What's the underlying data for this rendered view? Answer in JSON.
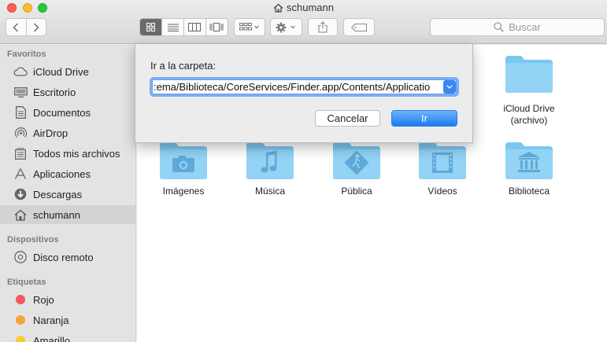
{
  "window": {
    "title": "schumann"
  },
  "toolbar": {
    "back_icon": "chevron-left-icon",
    "forward_icon": "chevron-right-icon",
    "view_modes": [
      "icon-view-icon",
      "list-view-icon",
      "column-view-icon",
      "coverflow-view-icon"
    ],
    "active_view": "icon-view-icon",
    "search_placeholder": "Buscar"
  },
  "sidebar": {
    "sections": [
      {
        "header": "Favoritos",
        "items": [
          {
            "label": "iCloud Drive",
            "icon": "cloud-icon"
          },
          {
            "label": "Escritorio",
            "icon": "desktop-icon"
          },
          {
            "label": "Documentos",
            "icon": "document-icon"
          },
          {
            "label": "AirDrop",
            "icon": "airdrop-icon"
          },
          {
            "label": "Todos mis archivos",
            "icon": "all-files-icon"
          },
          {
            "label": "Aplicaciones",
            "icon": "applications-icon"
          },
          {
            "label": "Descargas",
            "icon": "download-icon"
          },
          {
            "label": "schumann",
            "icon": "home-icon",
            "selected": true
          }
        ]
      },
      {
        "header": "Dispositivos",
        "items": [
          {
            "label": "Disco remoto",
            "icon": "disc-icon"
          }
        ]
      },
      {
        "header": "Etiquetas",
        "items": [
          {
            "label": "Rojo",
            "color": "#f4595b"
          },
          {
            "label": "Naranja",
            "color": "#f7a33a"
          },
          {
            "label": "Amarillo",
            "color": "#f3cf33"
          }
        ]
      }
    ]
  },
  "content": {
    "folders": [
      {
        "label": "iCloud Drive\n(archivo)",
        "icon": "folder-icon"
      },
      {
        "label": "Imágenes",
        "icon": "folder-pictures-icon"
      },
      {
        "label": "Música",
        "icon": "folder-music-icon"
      },
      {
        "label": "Pública",
        "icon": "folder-public-icon"
      },
      {
        "label": "Vídeos",
        "icon": "folder-movies-icon"
      },
      {
        "label": "Biblioteca",
        "icon": "folder-library-icon"
      }
    ]
  },
  "dialog": {
    "label": "Ir a la carpeta:",
    "path_value": ":ema/Biblioteca/CoreServices/Finder.app/Contents/Applicatio",
    "cancel_label": "Cancelar",
    "go_label": "Ir"
  },
  "colors": {
    "accent": "#1b7cf2",
    "folder": "#7cc7f1"
  }
}
